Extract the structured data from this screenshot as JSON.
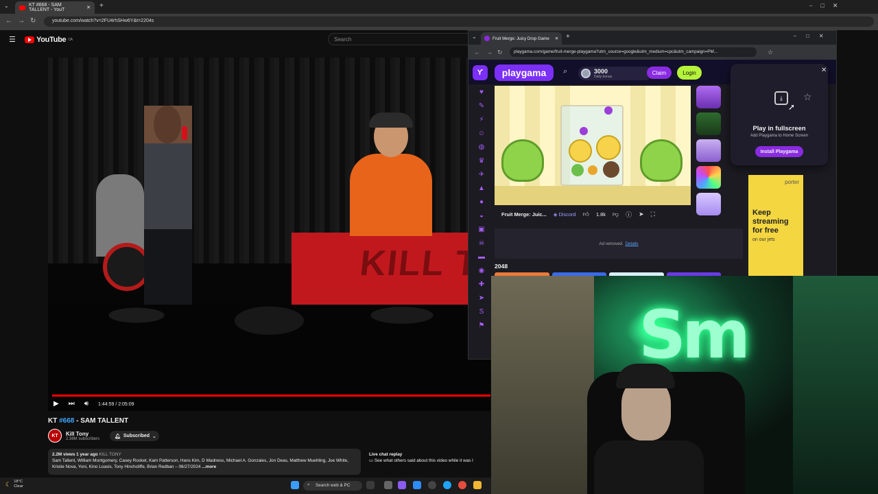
{
  "browser": {
    "tab_title": "KT #668 - SAM TALLENT - YouT",
    "url": "youtube.com/watch?v=2FU4rhSHw6Y&t=2204s"
  },
  "youtube": {
    "logo_text": "YouTube",
    "region": "CA",
    "search_placeholder": "Search",
    "video": {
      "time": "1:44:59 / 2:05:09",
      "title_prefix": "KT ",
      "title_hash": "#668",
      "title_rest": " - SAM TALLENT"
    },
    "channel": {
      "avatar": "KT",
      "name": "Kill Tony",
      "subs": "2.38M subscribers",
      "subscribe_label": "Subscribed"
    },
    "description": {
      "stats": "2.2M views  1 year ago",
      "tag": "KILL TONY",
      "text": "Sam Tallent, William Montgomery, Casey Rocket, Kam Patterson, Hans Kim, D Madness, Michael A. Gonzales, Jon Deas, Matthew Muehling, Joe White, Kristie Nova, Yoni, Kino Loasis, Tony Hinchcliffe, Brian Redban – 06/27/2024",
      "more": "...more"
    },
    "chat": {
      "title": "Live chat replay",
      "text": "See what others said about this video while it was l"
    }
  },
  "popup": {
    "tab_title": "Fruit Merge: Juicy Drop Game",
    "url": "playgama.com/game/fruit-merge-playgama?utm_source=google&utm_medium=cpc&utm_campaign=PM...",
    "site": {
      "logo": "playgama",
      "coins": "3000",
      "coins_sub": "Daily bonus",
      "claim": "Claim",
      "login": "Login"
    },
    "game": {
      "title": "Fruit Merge: Juic...",
      "discord": "Discord",
      "likes": "1.8k"
    },
    "ad": {
      "removed": "Ad removed.",
      "details": "Details"
    },
    "section": "2048",
    "fullscreen": {
      "title": "Play in fullscreen",
      "subtitle": "Add Playgama to Home Screen",
      "install": "Install Playgama"
    },
    "porter_ad": {
      "brand": "porter",
      "headline": "Keep streaming for free",
      "sub": "on our jets"
    }
  },
  "taskbar": {
    "temp": "18°C",
    "condition": "Clear",
    "search": "Search web & PC"
  }
}
